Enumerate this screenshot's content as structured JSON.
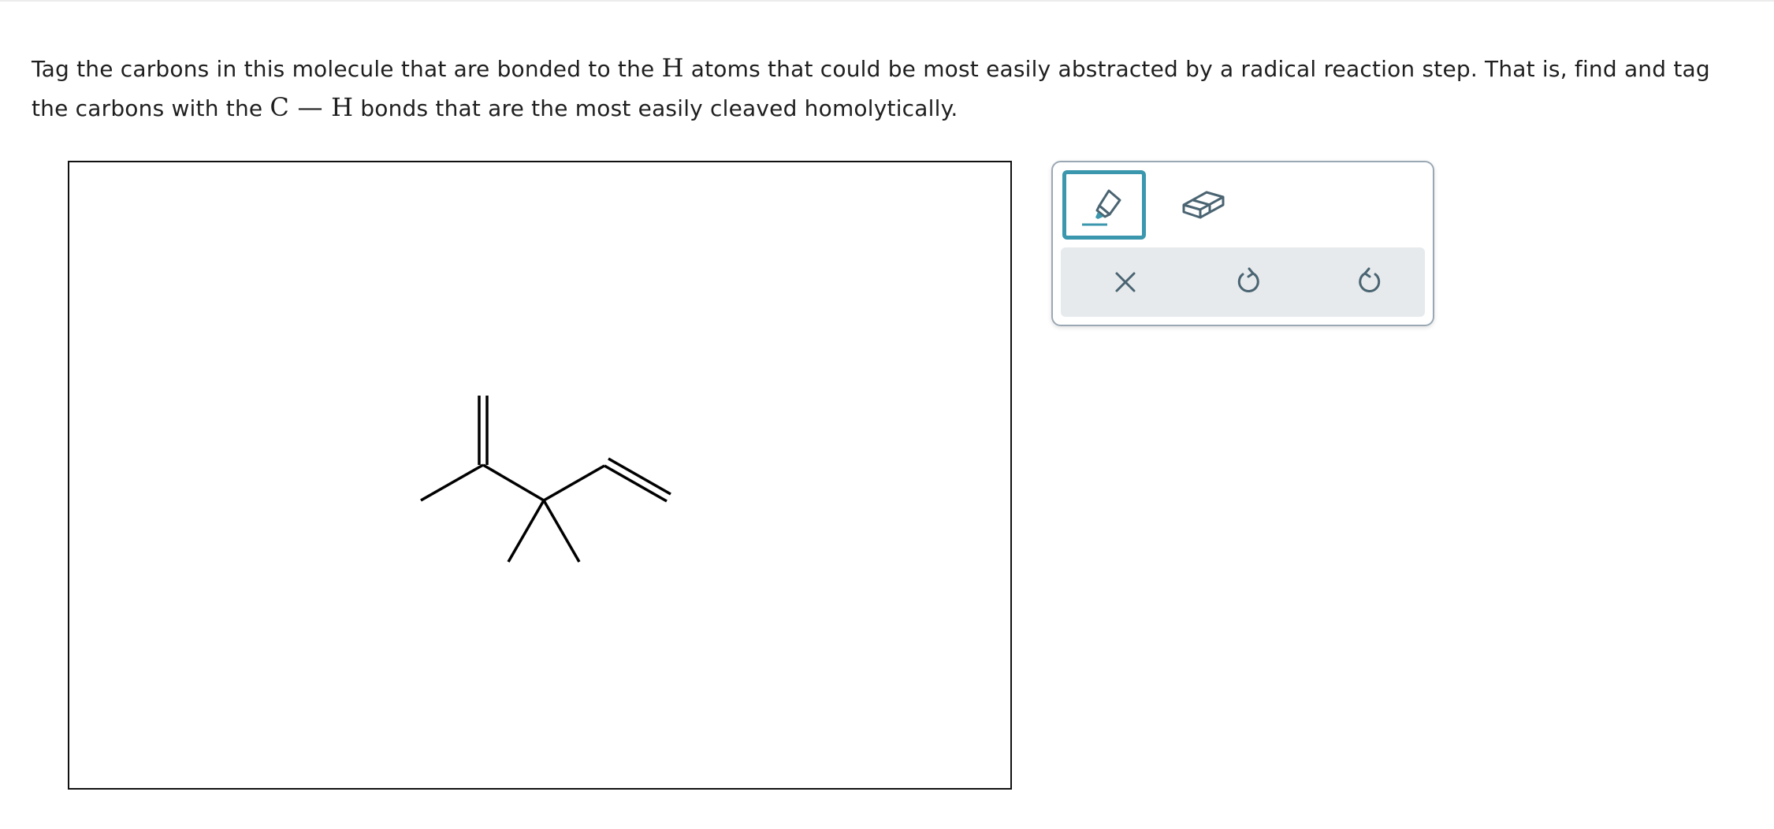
{
  "prompt": {
    "part1": "Tag the carbons in this molecule that are bonded to the ",
    "sym_h1": "H",
    "part2": " atoms that could be most easily abstracted by a radical reaction step. That is, find and tag the carbons with the ",
    "sym_c": "C",
    "dash": " — ",
    "sym_h2": "H",
    "part3": " bonds that are the most easily cleaved homolytically."
  },
  "toolbar": {
    "tools": [
      {
        "name": "tag",
        "icon": "highlighter-icon",
        "selected": true
      },
      {
        "name": "erase",
        "icon": "eraser-icon",
        "selected": false
      }
    ],
    "actions": [
      {
        "name": "clear",
        "icon": "close-icon"
      },
      {
        "name": "undo",
        "icon": "undo-icon"
      },
      {
        "name": "redo",
        "icon": "redo-icon"
      }
    ]
  },
  "colors": {
    "accent": "#3b97ad",
    "icon": "#4a6472",
    "toolbox_border": "#9aa8b4",
    "actions_bg": "#e6eaec",
    "bond": "#000000"
  }
}
